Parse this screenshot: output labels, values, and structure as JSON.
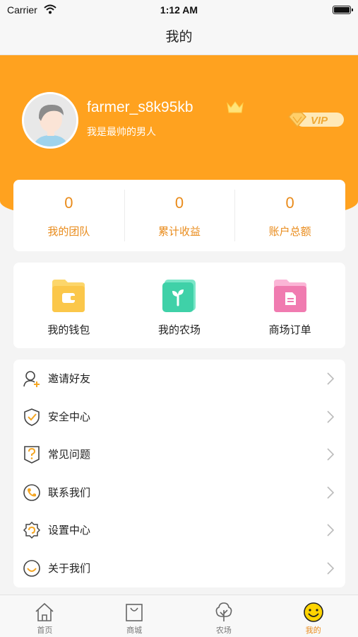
{
  "status_bar": {
    "carrier": "Carrier",
    "time": "1:12 AM"
  },
  "nav": {
    "title": "我的"
  },
  "profile": {
    "username": "farmer_s8k95kb",
    "signature": "我是最帅的男人",
    "badge": "VIP"
  },
  "stats": [
    {
      "value": "0",
      "label": "我的团队"
    },
    {
      "value": "0",
      "label": "累计收益"
    },
    {
      "value": "0",
      "label": "账户总额"
    }
  ],
  "quick_links": [
    {
      "label": "我的钱包",
      "icon": "wallet-icon"
    },
    {
      "label": "我的农场",
      "icon": "farm-sprout-icon"
    },
    {
      "label": "商场订单",
      "icon": "order-folder-icon"
    }
  ],
  "menu": [
    {
      "label": "邀请好友",
      "icon": "invite-user-icon"
    },
    {
      "label": "安全中心",
      "icon": "shield-check-icon"
    },
    {
      "label": "常见问题",
      "icon": "question-icon"
    },
    {
      "label": "联系我们",
      "icon": "phone-icon"
    },
    {
      "label": "设置中心",
      "icon": "settings-icon"
    },
    {
      "label": "关于我们",
      "icon": "smile-icon"
    }
  ],
  "tabs": [
    {
      "label": "首页",
      "icon": "home-icon"
    },
    {
      "label": "商城",
      "icon": "shopping-bag-icon"
    },
    {
      "label": "农场",
      "icon": "tree-icon"
    },
    {
      "label": "我的",
      "icon": "profile-smile-icon"
    }
  ],
  "colors": {
    "accent": "#ffa21f",
    "text_accent": "#e98b1b"
  }
}
